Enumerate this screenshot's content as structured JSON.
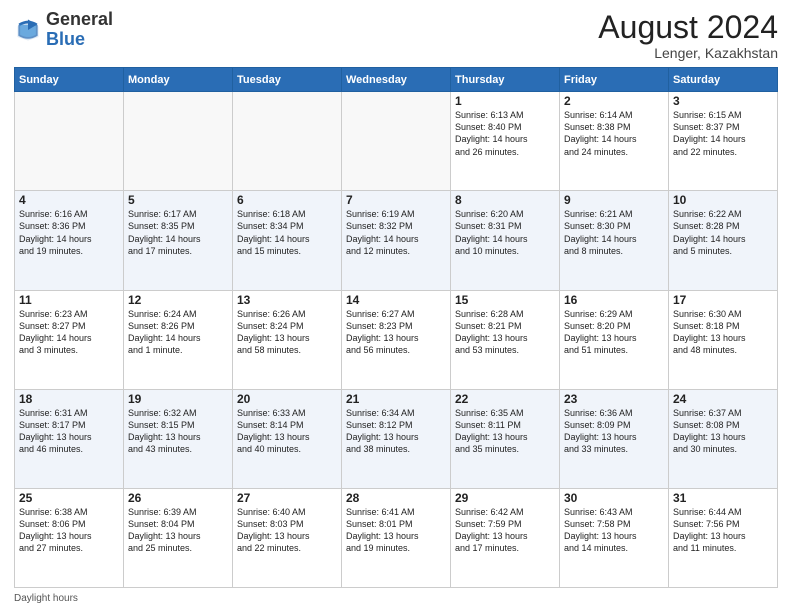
{
  "header": {
    "logo_general": "General",
    "logo_blue": "Blue",
    "month_title": "August 2024",
    "location": "Lenger, Kazakhstan"
  },
  "days_of_week": [
    "Sunday",
    "Monday",
    "Tuesday",
    "Wednesday",
    "Thursday",
    "Friday",
    "Saturday"
  ],
  "footer": {
    "daylight_label": "Daylight hours"
  },
  "weeks": [
    [
      {
        "day": "",
        "info": ""
      },
      {
        "day": "",
        "info": ""
      },
      {
        "day": "",
        "info": ""
      },
      {
        "day": "",
        "info": ""
      },
      {
        "day": "1",
        "info": "Sunrise: 6:13 AM\nSunset: 8:40 PM\nDaylight: 14 hours\nand 26 minutes."
      },
      {
        "day": "2",
        "info": "Sunrise: 6:14 AM\nSunset: 8:38 PM\nDaylight: 14 hours\nand 24 minutes."
      },
      {
        "day": "3",
        "info": "Sunrise: 6:15 AM\nSunset: 8:37 PM\nDaylight: 14 hours\nand 22 minutes."
      }
    ],
    [
      {
        "day": "4",
        "info": "Sunrise: 6:16 AM\nSunset: 8:36 PM\nDaylight: 14 hours\nand 19 minutes."
      },
      {
        "day": "5",
        "info": "Sunrise: 6:17 AM\nSunset: 8:35 PM\nDaylight: 14 hours\nand 17 minutes."
      },
      {
        "day": "6",
        "info": "Sunrise: 6:18 AM\nSunset: 8:34 PM\nDaylight: 14 hours\nand 15 minutes."
      },
      {
        "day": "7",
        "info": "Sunrise: 6:19 AM\nSunset: 8:32 PM\nDaylight: 14 hours\nand 12 minutes."
      },
      {
        "day": "8",
        "info": "Sunrise: 6:20 AM\nSunset: 8:31 PM\nDaylight: 14 hours\nand 10 minutes."
      },
      {
        "day": "9",
        "info": "Sunrise: 6:21 AM\nSunset: 8:30 PM\nDaylight: 14 hours\nand 8 minutes."
      },
      {
        "day": "10",
        "info": "Sunrise: 6:22 AM\nSunset: 8:28 PM\nDaylight: 14 hours\nand 5 minutes."
      }
    ],
    [
      {
        "day": "11",
        "info": "Sunrise: 6:23 AM\nSunset: 8:27 PM\nDaylight: 14 hours\nand 3 minutes."
      },
      {
        "day": "12",
        "info": "Sunrise: 6:24 AM\nSunset: 8:26 PM\nDaylight: 14 hours\nand 1 minute."
      },
      {
        "day": "13",
        "info": "Sunrise: 6:26 AM\nSunset: 8:24 PM\nDaylight: 13 hours\nand 58 minutes."
      },
      {
        "day": "14",
        "info": "Sunrise: 6:27 AM\nSunset: 8:23 PM\nDaylight: 13 hours\nand 56 minutes."
      },
      {
        "day": "15",
        "info": "Sunrise: 6:28 AM\nSunset: 8:21 PM\nDaylight: 13 hours\nand 53 minutes."
      },
      {
        "day": "16",
        "info": "Sunrise: 6:29 AM\nSunset: 8:20 PM\nDaylight: 13 hours\nand 51 minutes."
      },
      {
        "day": "17",
        "info": "Sunrise: 6:30 AM\nSunset: 8:18 PM\nDaylight: 13 hours\nand 48 minutes."
      }
    ],
    [
      {
        "day": "18",
        "info": "Sunrise: 6:31 AM\nSunset: 8:17 PM\nDaylight: 13 hours\nand 46 minutes."
      },
      {
        "day": "19",
        "info": "Sunrise: 6:32 AM\nSunset: 8:15 PM\nDaylight: 13 hours\nand 43 minutes."
      },
      {
        "day": "20",
        "info": "Sunrise: 6:33 AM\nSunset: 8:14 PM\nDaylight: 13 hours\nand 40 minutes."
      },
      {
        "day": "21",
        "info": "Sunrise: 6:34 AM\nSunset: 8:12 PM\nDaylight: 13 hours\nand 38 minutes."
      },
      {
        "day": "22",
        "info": "Sunrise: 6:35 AM\nSunset: 8:11 PM\nDaylight: 13 hours\nand 35 minutes."
      },
      {
        "day": "23",
        "info": "Sunrise: 6:36 AM\nSunset: 8:09 PM\nDaylight: 13 hours\nand 33 minutes."
      },
      {
        "day": "24",
        "info": "Sunrise: 6:37 AM\nSunset: 8:08 PM\nDaylight: 13 hours\nand 30 minutes."
      }
    ],
    [
      {
        "day": "25",
        "info": "Sunrise: 6:38 AM\nSunset: 8:06 PM\nDaylight: 13 hours\nand 27 minutes."
      },
      {
        "day": "26",
        "info": "Sunrise: 6:39 AM\nSunset: 8:04 PM\nDaylight: 13 hours\nand 25 minutes."
      },
      {
        "day": "27",
        "info": "Sunrise: 6:40 AM\nSunset: 8:03 PM\nDaylight: 13 hours\nand 22 minutes."
      },
      {
        "day": "28",
        "info": "Sunrise: 6:41 AM\nSunset: 8:01 PM\nDaylight: 13 hours\nand 19 minutes."
      },
      {
        "day": "29",
        "info": "Sunrise: 6:42 AM\nSunset: 7:59 PM\nDaylight: 13 hours\nand 17 minutes."
      },
      {
        "day": "30",
        "info": "Sunrise: 6:43 AM\nSunset: 7:58 PM\nDaylight: 13 hours\nand 14 minutes."
      },
      {
        "day": "31",
        "info": "Sunrise: 6:44 AM\nSunset: 7:56 PM\nDaylight: 13 hours\nand 11 minutes."
      }
    ]
  ]
}
